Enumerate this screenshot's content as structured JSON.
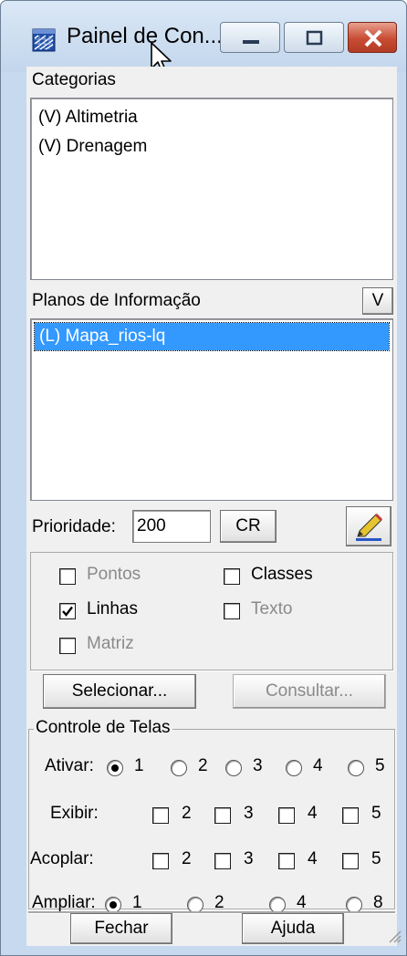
{
  "window": {
    "title": "Painel de Con...",
    "icons": {
      "app": "grid-window-icon",
      "minimize": "minimize-icon",
      "maximize": "maximize-icon",
      "close": "close-icon",
      "cursor": "mouse-pointer-icon"
    }
  },
  "categorias": {
    "label": "Categorias",
    "items": [
      "(V) Altimetria",
      "(V) Drenagem"
    ]
  },
  "planos": {
    "label": "Planos de Informação",
    "v_button": "V",
    "items": [
      "(L) Mapa_rios-lq"
    ],
    "selected": "(L) Mapa_rios-lq"
  },
  "prioridade": {
    "label": "Prioridade:",
    "value": "200",
    "cr_button": "CR",
    "color_icon": "pencil-color-icon"
  },
  "representacao": {
    "pontos": {
      "label": "Pontos",
      "checked": false,
      "enabled": false
    },
    "classes": {
      "label": "Classes",
      "checked": false,
      "enabled": true
    },
    "linhas": {
      "label": "Linhas",
      "checked": true,
      "enabled": true
    },
    "texto": {
      "label": "Texto",
      "checked": false,
      "enabled": false
    },
    "matriz": {
      "label": "Matriz",
      "checked": false,
      "enabled": false
    }
  },
  "buttons": {
    "selecionar": "Selecionar...",
    "consultar": "Consultar...",
    "fechar": "Fechar",
    "ajuda": "Ajuda"
  },
  "controle": {
    "title": "Controle de Telas",
    "ativar": {
      "label": "Ativar:",
      "options": [
        "1",
        "2",
        "3",
        "4",
        "5"
      ],
      "selected": "1"
    },
    "exibir": {
      "label": "Exibir:",
      "options": [
        "2",
        "3",
        "4",
        "5"
      ]
    },
    "acoplar": {
      "label": "Acoplar:",
      "options": [
        "2",
        "3",
        "4",
        "5"
      ]
    },
    "ampliar": {
      "label": "Ampliar:",
      "options": [
        "1",
        "2",
        "4",
        "8"
      ],
      "selected": "1"
    }
  }
}
